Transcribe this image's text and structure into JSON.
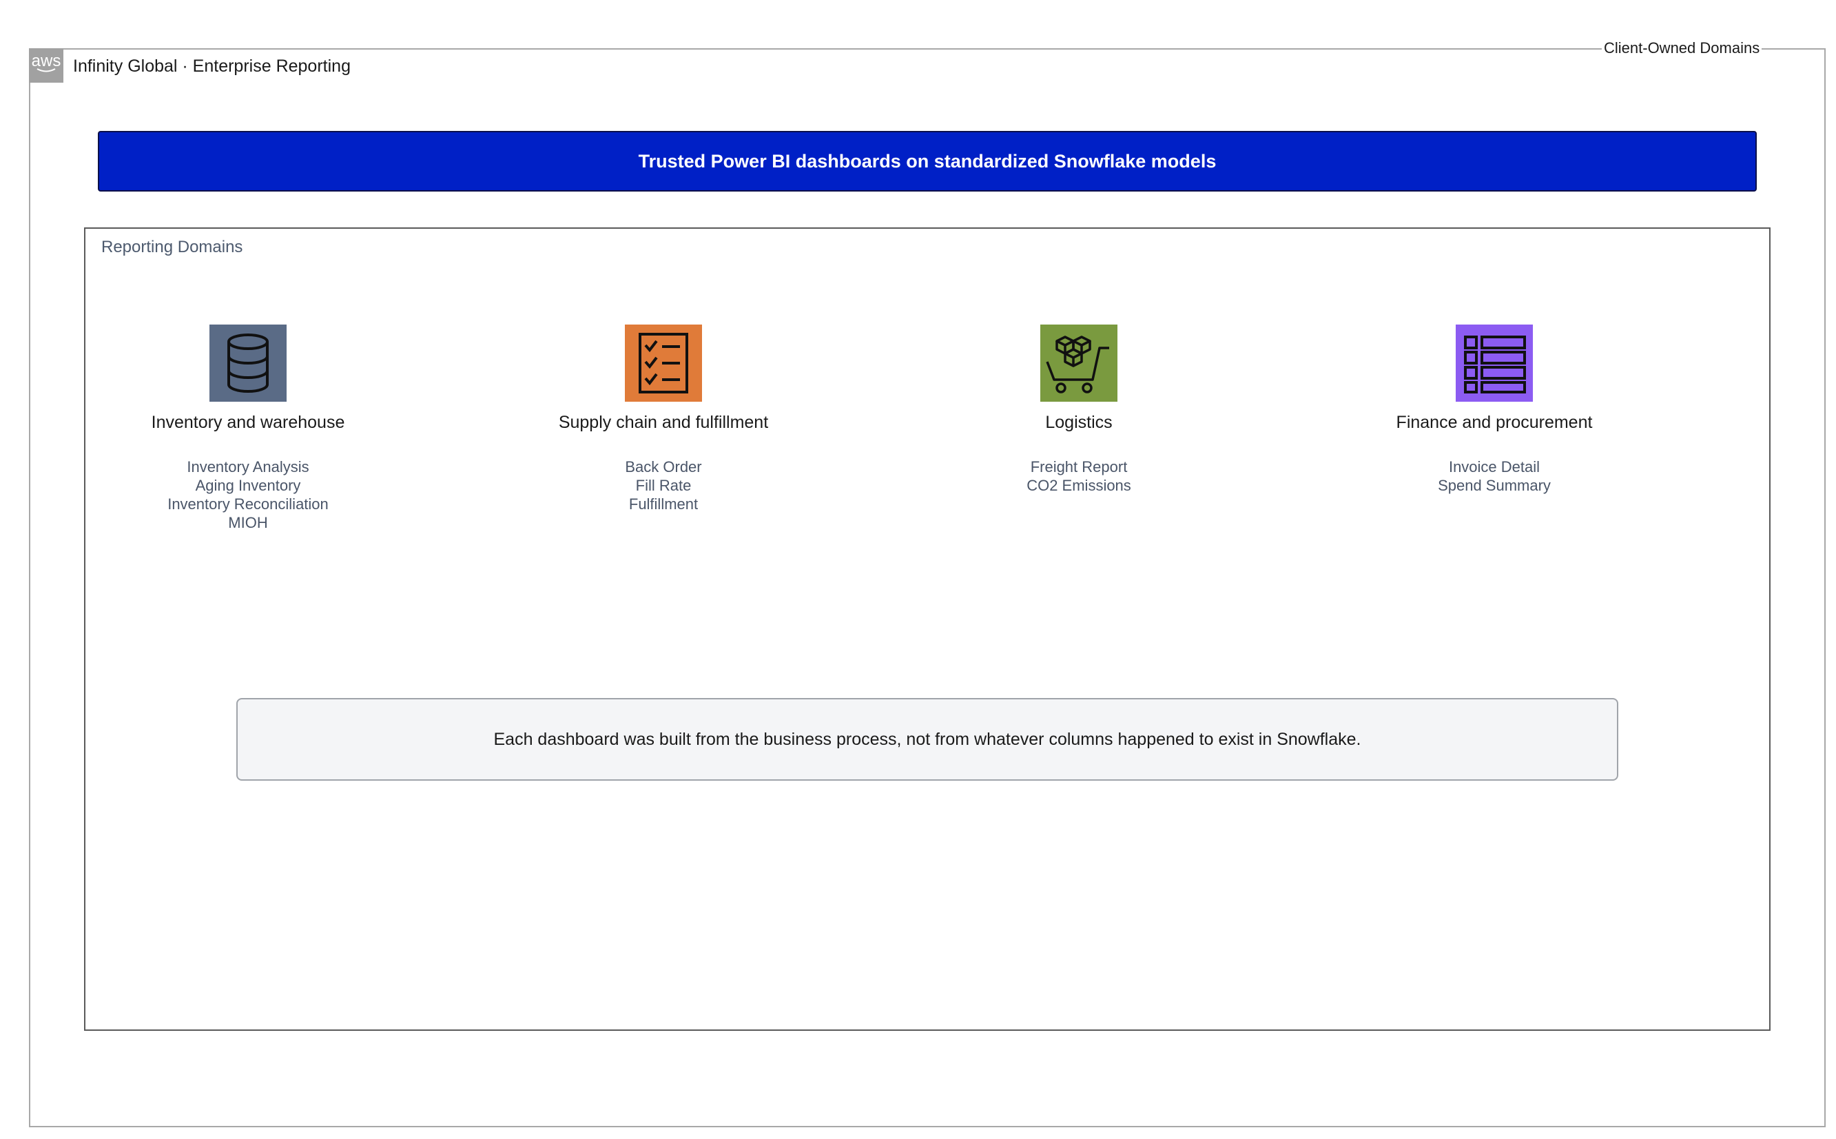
{
  "header": {
    "badge_text": "aws",
    "title": "Infinity Global · Enterprise Reporting",
    "corner_label": "Client-Owned Domains"
  },
  "banner": {
    "text": "Trusted Power BI dashboards on standardized Snowflake models",
    "color": "#0020c6"
  },
  "reporting": {
    "label": "Reporting Domains",
    "domains": [
      {
        "name": "Inventory and warehouse",
        "icon": "database-icon",
        "color": "#5a6b86",
        "reports": [
          "Inventory Analysis",
          "Aging Inventory",
          "Inventory Reconciliation",
          "MIOH"
        ]
      },
      {
        "name": "Supply chain and fulfillment",
        "icon": "checklist-icon",
        "color": "#e07b39",
        "reports": [
          "Back Order",
          "Fill Rate",
          "Fulfillment"
        ]
      },
      {
        "name": "Logistics",
        "icon": "shopping-cart-packages-icon",
        "color": "#7a9a3f",
        "reports": [
          "Freight Report",
          "CO2 Emissions"
        ]
      },
      {
        "name": "Finance and procurement",
        "icon": "table-list-icon",
        "color": "#8c5cf2",
        "reports": [
          "Invoice Detail",
          "Spend Summary"
        ]
      }
    ]
  },
  "note": {
    "text": "Each dashboard was built from the business process, not from whatever columns happened to exist in Snowflake."
  }
}
